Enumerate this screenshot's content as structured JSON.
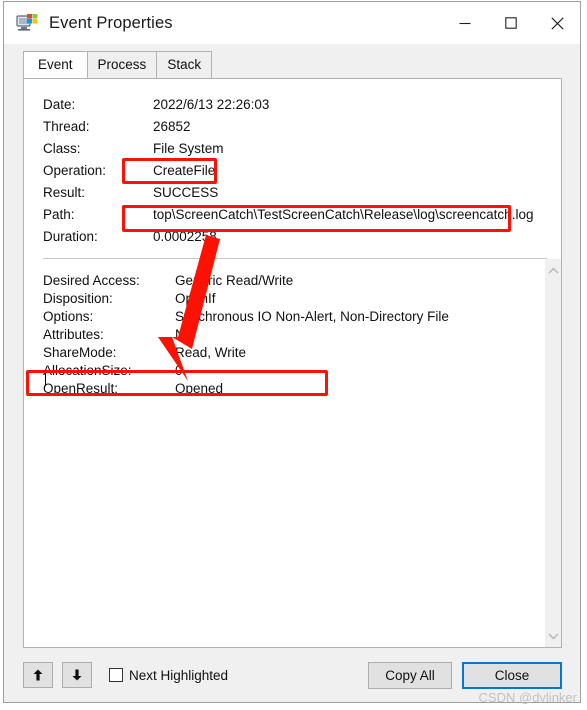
{
  "window": {
    "title": "Event Properties",
    "icon": "procmon-icon",
    "controls": {
      "minimize": "minimize-icon",
      "maximize": "maximize-icon",
      "close": "close-icon"
    }
  },
  "tabs": [
    {
      "label": "Event",
      "active": true
    },
    {
      "label": "Process",
      "active": false
    },
    {
      "label": "Stack",
      "active": false
    }
  ],
  "summary": [
    {
      "label": "Date:",
      "value": "2022/6/13 22:26:03"
    },
    {
      "label": "Thread:",
      "value": "26852"
    },
    {
      "label": "Class:",
      "value": "File System"
    },
    {
      "label": "Operation:",
      "value": "CreateFile"
    },
    {
      "label": "Result:",
      "value": "SUCCESS"
    },
    {
      "label": "Path:",
      "value": "top\\ScreenCatch\\TestScreenCatch\\Release\\log\\screencatch.log"
    },
    {
      "label": "Duration:",
      "value": "0.0002258"
    }
  ],
  "details": [
    {
      "label": "Desired Access:",
      "value": "Generic Read/Write"
    },
    {
      "label": "Disposition:",
      "value": "OpenIf"
    },
    {
      "label": "Options:",
      "value": "Synchronous IO Non-Alert, Non-Directory File"
    },
    {
      "label": "Attributes:",
      "value": "N"
    },
    {
      "label": "ShareMode:",
      "value": "Read, Write"
    },
    {
      "label": "AllocationSize:",
      "value": "0"
    },
    {
      "label": "OpenResult:",
      "value": "Opened"
    }
  ],
  "scrollbar": {
    "up": "chevron-up-icon",
    "down": "chevron-down-icon"
  },
  "bottom": {
    "prev": "arrow-up-icon",
    "next": "arrow-down-icon",
    "checkbox_label": "Next Highlighted",
    "checkbox_checked": false,
    "copy_all_label": "Copy All",
    "close_label": "Close"
  },
  "watermark": "CSDN @dvlinker",
  "annotations": {
    "highlight_color": "#fb1202",
    "boxes": [
      {
        "name": "operation-highlight",
        "target": "CreateFile"
      },
      {
        "name": "path-highlight",
        "target": "top\\ScreenCatch\\TestScreenCatch\\Release\\log\\screencatch.log"
      },
      {
        "name": "openresult-highlight",
        "target": "OpenResult: Opened"
      }
    ],
    "arrow": {
      "name": "pointer-arrow",
      "from": "path-highlight",
      "to": "openresult-highlight"
    }
  }
}
